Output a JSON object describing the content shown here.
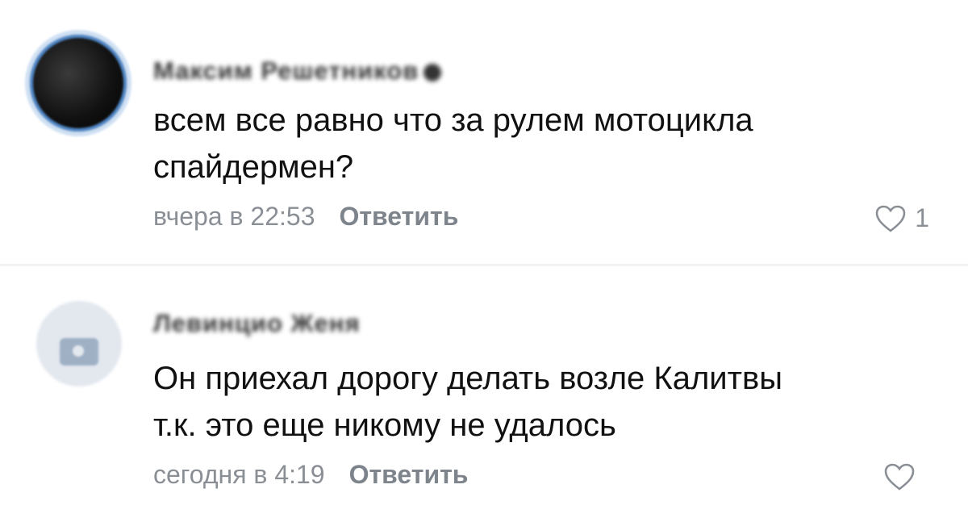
{
  "comments": [
    {
      "author": "Максим Решетников",
      "text_lines": [
        "всем все равно что за рулем мотоцикла",
        "спайдермен?"
      ],
      "time": "вчера в 22:53",
      "reply_label": "Ответить",
      "likes": "1"
    },
    {
      "author": "Левинцио Женя",
      "text_lines": [
        "Он приехал дорогу делать возле Калитвы",
        "т.к. это еще никому не удалось"
      ],
      "time": "сегодня в 4:19",
      "reply_label": "Ответить",
      "likes": ""
    }
  ],
  "icons": {
    "like": "heart-outline-icon",
    "avatar_placeholder": "camera-icon"
  },
  "colors": {
    "meta": "#8a8f96",
    "text": "#111111",
    "avatar_ring": "#4f86c6"
  }
}
